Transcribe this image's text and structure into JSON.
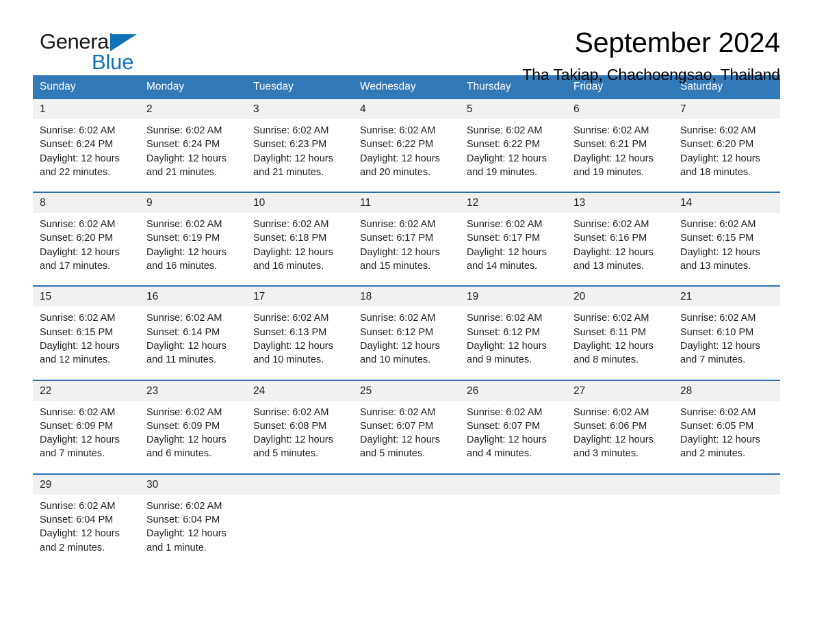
{
  "brand": {
    "name_part1": "General",
    "name_part2": "Blue",
    "triangle_icon": "triangle-icon",
    "accent_color": "#1272b8"
  },
  "header": {
    "title": "September 2024",
    "subtitle": "Tha Takiap, Chachoengsao, Thailand"
  },
  "theme": {
    "header_bg": "#3279b7",
    "daynum_bg": "#f1f1f1",
    "row_divider": "#2c6fae",
    "text": "#222222"
  },
  "calendar": {
    "weekdays": [
      "Sunday",
      "Monday",
      "Tuesday",
      "Wednesday",
      "Thursday",
      "Friday",
      "Saturday"
    ],
    "weeks": [
      [
        {
          "day": "1",
          "sunrise": "Sunrise: 6:02 AM",
          "sunset": "Sunset: 6:24 PM",
          "daylight1": "Daylight: 12 hours",
          "daylight2": "and 22 minutes."
        },
        {
          "day": "2",
          "sunrise": "Sunrise: 6:02 AM",
          "sunset": "Sunset: 6:24 PM",
          "daylight1": "Daylight: 12 hours",
          "daylight2": "and 21 minutes."
        },
        {
          "day": "3",
          "sunrise": "Sunrise: 6:02 AM",
          "sunset": "Sunset: 6:23 PM",
          "daylight1": "Daylight: 12 hours",
          "daylight2": "and 21 minutes."
        },
        {
          "day": "4",
          "sunrise": "Sunrise: 6:02 AM",
          "sunset": "Sunset: 6:22 PM",
          "daylight1": "Daylight: 12 hours",
          "daylight2": "and 20 minutes."
        },
        {
          "day": "5",
          "sunrise": "Sunrise: 6:02 AM",
          "sunset": "Sunset: 6:22 PM",
          "daylight1": "Daylight: 12 hours",
          "daylight2": "and 19 minutes."
        },
        {
          "day": "6",
          "sunrise": "Sunrise: 6:02 AM",
          "sunset": "Sunset: 6:21 PM",
          "daylight1": "Daylight: 12 hours",
          "daylight2": "and 19 minutes."
        },
        {
          "day": "7",
          "sunrise": "Sunrise: 6:02 AM",
          "sunset": "Sunset: 6:20 PM",
          "daylight1": "Daylight: 12 hours",
          "daylight2": "and 18 minutes."
        }
      ],
      [
        {
          "day": "8",
          "sunrise": "Sunrise: 6:02 AM",
          "sunset": "Sunset: 6:20 PM",
          "daylight1": "Daylight: 12 hours",
          "daylight2": "and 17 minutes."
        },
        {
          "day": "9",
          "sunrise": "Sunrise: 6:02 AM",
          "sunset": "Sunset: 6:19 PM",
          "daylight1": "Daylight: 12 hours",
          "daylight2": "and 16 minutes."
        },
        {
          "day": "10",
          "sunrise": "Sunrise: 6:02 AM",
          "sunset": "Sunset: 6:18 PM",
          "daylight1": "Daylight: 12 hours",
          "daylight2": "and 16 minutes."
        },
        {
          "day": "11",
          "sunrise": "Sunrise: 6:02 AM",
          "sunset": "Sunset: 6:17 PM",
          "daylight1": "Daylight: 12 hours",
          "daylight2": "and 15 minutes."
        },
        {
          "day": "12",
          "sunrise": "Sunrise: 6:02 AM",
          "sunset": "Sunset: 6:17 PM",
          "daylight1": "Daylight: 12 hours",
          "daylight2": "and 14 minutes."
        },
        {
          "day": "13",
          "sunrise": "Sunrise: 6:02 AM",
          "sunset": "Sunset: 6:16 PM",
          "daylight1": "Daylight: 12 hours",
          "daylight2": "and 13 minutes."
        },
        {
          "day": "14",
          "sunrise": "Sunrise: 6:02 AM",
          "sunset": "Sunset: 6:15 PM",
          "daylight1": "Daylight: 12 hours",
          "daylight2": "and 13 minutes."
        }
      ],
      [
        {
          "day": "15",
          "sunrise": "Sunrise: 6:02 AM",
          "sunset": "Sunset: 6:15 PM",
          "daylight1": "Daylight: 12 hours",
          "daylight2": "and 12 minutes."
        },
        {
          "day": "16",
          "sunrise": "Sunrise: 6:02 AM",
          "sunset": "Sunset: 6:14 PM",
          "daylight1": "Daylight: 12 hours",
          "daylight2": "and 11 minutes."
        },
        {
          "day": "17",
          "sunrise": "Sunrise: 6:02 AM",
          "sunset": "Sunset: 6:13 PM",
          "daylight1": "Daylight: 12 hours",
          "daylight2": "and 10 minutes."
        },
        {
          "day": "18",
          "sunrise": "Sunrise: 6:02 AM",
          "sunset": "Sunset: 6:12 PM",
          "daylight1": "Daylight: 12 hours",
          "daylight2": "and 10 minutes."
        },
        {
          "day": "19",
          "sunrise": "Sunrise: 6:02 AM",
          "sunset": "Sunset: 6:12 PM",
          "daylight1": "Daylight: 12 hours",
          "daylight2": "and 9 minutes."
        },
        {
          "day": "20",
          "sunrise": "Sunrise: 6:02 AM",
          "sunset": "Sunset: 6:11 PM",
          "daylight1": "Daylight: 12 hours",
          "daylight2": "and 8 minutes."
        },
        {
          "day": "21",
          "sunrise": "Sunrise: 6:02 AM",
          "sunset": "Sunset: 6:10 PM",
          "daylight1": "Daylight: 12 hours",
          "daylight2": "and 7 minutes."
        }
      ],
      [
        {
          "day": "22",
          "sunrise": "Sunrise: 6:02 AM",
          "sunset": "Sunset: 6:09 PM",
          "daylight1": "Daylight: 12 hours",
          "daylight2": "and 7 minutes."
        },
        {
          "day": "23",
          "sunrise": "Sunrise: 6:02 AM",
          "sunset": "Sunset: 6:09 PM",
          "daylight1": "Daylight: 12 hours",
          "daylight2": "and 6 minutes."
        },
        {
          "day": "24",
          "sunrise": "Sunrise: 6:02 AM",
          "sunset": "Sunset: 6:08 PM",
          "daylight1": "Daylight: 12 hours",
          "daylight2": "and 5 minutes."
        },
        {
          "day": "25",
          "sunrise": "Sunrise: 6:02 AM",
          "sunset": "Sunset: 6:07 PM",
          "daylight1": "Daylight: 12 hours",
          "daylight2": "and 5 minutes."
        },
        {
          "day": "26",
          "sunrise": "Sunrise: 6:02 AM",
          "sunset": "Sunset: 6:07 PM",
          "daylight1": "Daylight: 12 hours",
          "daylight2": "and 4 minutes."
        },
        {
          "day": "27",
          "sunrise": "Sunrise: 6:02 AM",
          "sunset": "Sunset: 6:06 PM",
          "daylight1": "Daylight: 12 hours",
          "daylight2": "and 3 minutes."
        },
        {
          "day": "28",
          "sunrise": "Sunrise: 6:02 AM",
          "sunset": "Sunset: 6:05 PM",
          "daylight1": "Daylight: 12 hours",
          "daylight2": "and 2 minutes."
        }
      ],
      [
        {
          "day": "29",
          "sunrise": "Sunrise: 6:02 AM",
          "sunset": "Sunset: 6:04 PM",
          "daylight1": "Daylight: 12 hours",
          "daylight2": "and 2 minutes."
        },
        {
          "day": "30",
          "sunrise": "Sunrise: 6:02 AM",
          "sunset": "Sunset: 6:04 PM",
          "daylight1": "Daylight: 12 hours",
          "daylight2": "and 1 minute."
        },
        {
          "day": "",
          "sunrise": "",
          "sunset": "",
          "daylight1": "",
          "daylight2": ""
        },
        {
          "day": "",
          "sunrise": "",
          "sunset": "",
          "daylight1": "",
          "daylight2": ""
        },
        {
          "day": "",
          "sunrise": "",
          "sunset": "",
          "daylight1": "",
          "daylight2": ""
        },
        {
          "day": "",
          "sunrise": "",
          "sunset": "",
          "daylight1": "",
          "daylight2": ""
        },
        {
          "day": "",
          "sunrise": "",
          "sunset": "",
          "daylight1": "",
          "daylight2": ""
        }
      ]
    ]
  }
}
